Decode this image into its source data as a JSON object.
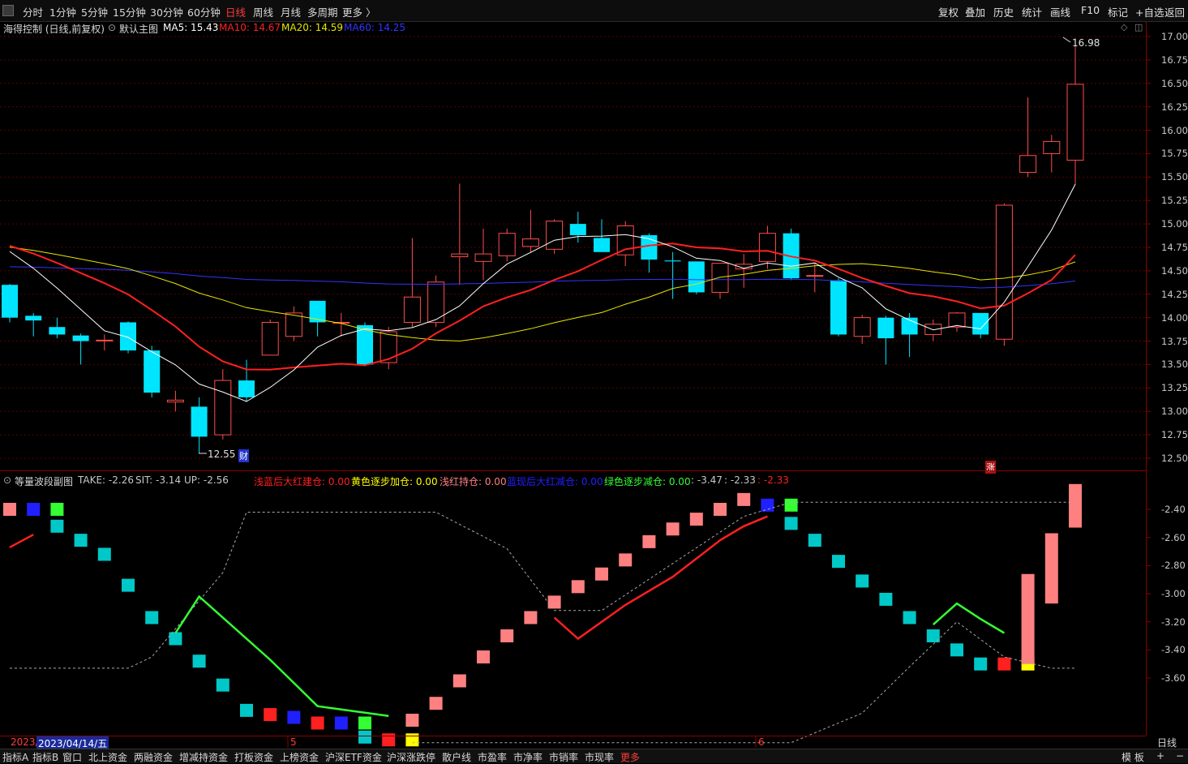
{
  "toolbar": {
    "periods": [
      "分时",
      "1分钟",
      "5分钟",
      "15分钟",
      "30分钟",
      "60分钟",
      "日线",
      "周线",
      "月线",
      "多周期",
      "更多 〉"
    ],
    "active_period": "日线",
    "right_items": [
      "复权",
      "叠加",
      "历史",
      "统计",
      "画线",
      "F10",
      "标记",
      "+自选",
      "返回"
    ]
  },
  "main_chart": {
    "stock_title": "海得控制 (日线,前复权)",
    "template": "默认主图",
    "ma5": "MA5: 15.43",
    "ma10": "MA10: 14.67",
    "ma20": "MA20: 14.59",
    "ma60": "MA60: 14.25",
    "high_label": "16.98",
    "low_label": "12.55",
    "marker_cai": "财",
    "marker_zhang": "涨",
    "y_ticks": [
      "17.00",
      "16.75",
      "16.50",
      "16.25",
      "16.00",
      "15.75",
      "15.50",
      "15.25",
      "15.00",
      "14.75",
      "14.50",
      "14.25",
      "14.00",
      "13.75",
      "13.50",
      "13.25",
      "13.00",
      "12.75",
      "12.50"
    ]
  },
  "indicator": {
    "name": "等量波段副图",
    "take": "TAKE: -2.26",
    "sit": "SIT: -3.14",
    "up": "UP: -2.56",
    "items": [
      {
        "label": "浅蓝后大红建仓: 0.00",
        "color": "#ff2020"
      },
      {
        "label": "黄色逐步加仓: 0.00",
        "color": "#ffff00"
      },
      {
        "label": "浅红持仓: 0.00",
        "color": "#ff8080"
      },
      {
        "label": "蓝现后大红减仓: 0.00",
        "color": "#2020ff"
      },
      {
        "label": "绿色逐步减仓: 0.00",
        "color": "#33ff33"
      },
      {
        "label": ": -3.47",
        "color": "#c8c8c8"
      },
      {
        "label": ": -2.33",
        "color": "#c8c8c8"
      },
      {
        "label": ": -2.33",
        "color": "#ff2020"
      }
    ],
    "y_ticks": [
      "-2.40",
      "-2.60",
      "-2.80",
      "-3.00",
      "-3.20",
      "-3.40",
      "-3.60"
    ]
  },
  "datebar": {
    "start_label": "2023/",
    "cursor_date": "2023/04/14/五",
    "month5": "5",
    "month6": "6",
    "period": "日线"
  },
  "bottom_tabs": [
    "指标A",
    "指标B",
    "窗口",
    "北上资金",
    "两融资金",
    "增减持资金",
    "打板资金",
    "上榜资金",
    "沪深ETF资金",
    "沪深涨跌停",
    "散户线",
    "市盈率",
    "市净率",
    "市销率",
    "市现率",
    "更多"
  ],
  "bottom_right": [
    "模 板",
    "+",
    "−"
  ],
  "colors": {
    "up": "#ff4d4d",
    "down": "#00e5ff",
    "ma5": "#ffffff",
    "ma10": "#ff2020",
    "ma20": "#e6e600",
    "ma60": "#3333ff",
    "axis": "#8b0000"
  },
  "chart_data": {
    "type": "candlestick",
    "candles": [
      [
        14.35,
        14.0,
        14.36,
        13.95
      ],
      [
        14.02,
        13.97,
        14.05,
        13.8
      ],
      [
        13.9,
        13.82,
        14.0,
        13.78
      ],
      [
        13.81,
        13.75,
        13.83,
        13.5
      ],
      [
        13.76,
        13.76,
        13.82,
        13.65
      ],
      [
        13.95,
        13.65,
        13.96,
        13.62
      ],
      [
        13.65,
        13.2,
        13.7,
        13.15
      ],
      [
        13.1,
        13.12,
        13.22,
        13.0
      ],
      [
        13.05,
        12.73,
        13.15,
        12.55
      ],
      [
        12.75,
        13.33,
        13.45,
        12.7
      ],
      [
        13.33,
        13.15,
        13.55,
        13.1
      ],
      [
        13.6,
        13.95,
        13.98,
        13.6
      ],
      [
        13.8,
        14.05,
        14.12,
        13.75
      ],
      [
        14.18,
        13.95,
        14.18,
        13.8
      ],
      [
        13.95,
        13.95,
        14.05,
        13.8
      ],
      [
        13.92,
        13.5,
        13.95,
        13.48
      ],
      [
        13.52,
        13.85,
        13.9,
        13.45
      ],
      [
        13.95,
        14.22,
        14.85,
        13.9
      ],
      [
        13.95,
        14.38,
        14.45,
        13.9
      ],
      [
        14.65,
        14.68,
        15.43,
        14.35
      ],
      [
        14.6,
        14.68,
        14.95,
        14.4
      ],
      [
        14.66,
        14.9,
        14.95,
        14.6
      ],
      [
        14.76,
        14.84,
        15.15,
        14.7
      ],
      [
        14.73,
        15.03,
        15.05,
        14.68
      ],
      [
        15.0,
        14.88,
        15.13,
        14.8
      ],
      [
        14.85,
        14.7,
        15.05,
        14.7
      ],
      [
        14.67,
        14.98,
        15.03,
        14.55
      ],
      [
        14.88,
        14.62,
        14.9,
        14.48
      ],
      [
        14.61,
        14.6,
        14.7,
        14.2
      ],
      [
        14.6,
        14.27,
        14.6,
        14.25
      ],
      [
        14.27,
        14.58,
        14.58,
        14.2
      ],
      [
        14.52,
        14.57,
        14.68,
        14.32
      ],
      [
        14.6,
        14.9,
        14.98,
        14.52
      ],
      [
        14.9,
        14.42,
        14.95,
        14.4
      ],
      [
        14.45,
        14.45,
        14.58,
        14.27
      ],
      [
        14.4,
        13.82,
        14.42,
        13.8
      ],
      [
        13.8,
        14.0,
        14.03,
        13.72
      ],
      [
        14.0,
        13.78,
        14.02,
        13.5
      ],
      [
        14.0,
        13.82,
        14.05,
        13.58
      ],
      [
        13.82,
        13.93,
        13.98,
        13.75
      ],
      [
        13.9,
        14.05,
        14.06,
        13.85
      ],
      [
        14.05,
        13.82,
        14.05,
        13.78
      ],
      [
        13.77,
        15.2,
        15.22,
        13.7
      ],
      [
        15.55,
        15.73,
        16.35,
        15.5
      ],
      [
        15.75,
        15.88,
        15.95,
        15.55
      ],
      [
        15.68,
        16.49,
        16.98,
        15.42
      ]
    ],
    "y_range": [
      12.5,
      17.0
    ]
  }
}
